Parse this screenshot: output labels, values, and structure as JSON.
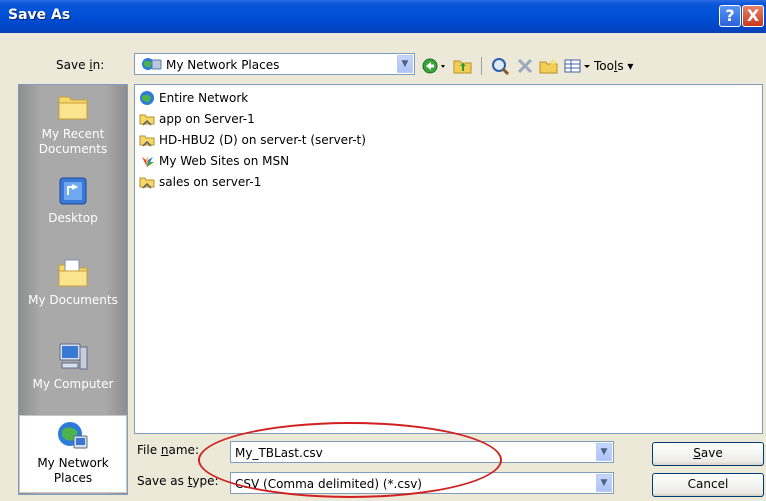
{
  "window": {
    "title": "Save As",
    "help_glyph": "?",
    "close_glyph": "X"
  },
  "save_in": {
    "label_prefix": "Save ",
    "label_accel": "i",
    "label_suffix": "n:",
    "location": "My Network Places",
    "dropdown_glyph": "▼"
  },
  "toolbar": {
    "tools_prefix": "Too",
    "tools_accel": "l",
    "tools_suffix": "s",
    "dropdown_glyph": "▾"
  },
  "places": [
    {
      "line1": "My Recent",
      "line2": "Documents",
      "icon": "recent-documents-icon"
    },
    {
      "line1": "Desktop",
      "line2": "",
      "icon": "desktop-icon"
    },
    {
      "line1": "My Documents",
      "line2": "",
      "icon": "my-documents-icon"
    },
    {
      "line1": "My Computer",
      "line2": "",
      "icon": "my-computer-icon"
    },
    {
      "line1": "My Network",
      "line2": "Places",
      "icon": "network-places-icon"
    }
  ],
  "files": [
    {
      "name": "Entire Network",
      "icon": "globe-icon"
    },
    {
      "name": "app on Server-1",
      "icon": "network-folder-icon"
    },
    {
      "name": "HD-HBU2 (D) on server-t (server-t)",
      "icon": "network-folder-icon"
    },
    {
      "name": "My Web Sites on MSN",
      "icon": "msn-icon"
    },
    {
      "name": "sales on server-1",
      "icon": "network-folder-icon"
    }
  ],
  "file_name": {
    "label_prefix": "File ",
    "label_accel": "n",
    "label_suffix": "ame:",
    "value": "My_TBLast.csv"
  },
  "save_type": {
    "label_prefix": "Save as ",
    "label_accel": "t",
    "label_suffix": "ype:",
    "value": "CSV (Comma delimited) (*.csv)"
  },
  "buttons": {
    "save_accel": "S",
    "save_rest": "ave",
    "cancel": "Cancel"
  },
  "colors": {
    "titlebar": "#0050D8",
    "dialog_bg": "#ECE9D8",
    "annotation": "#D02020"
  }
}
